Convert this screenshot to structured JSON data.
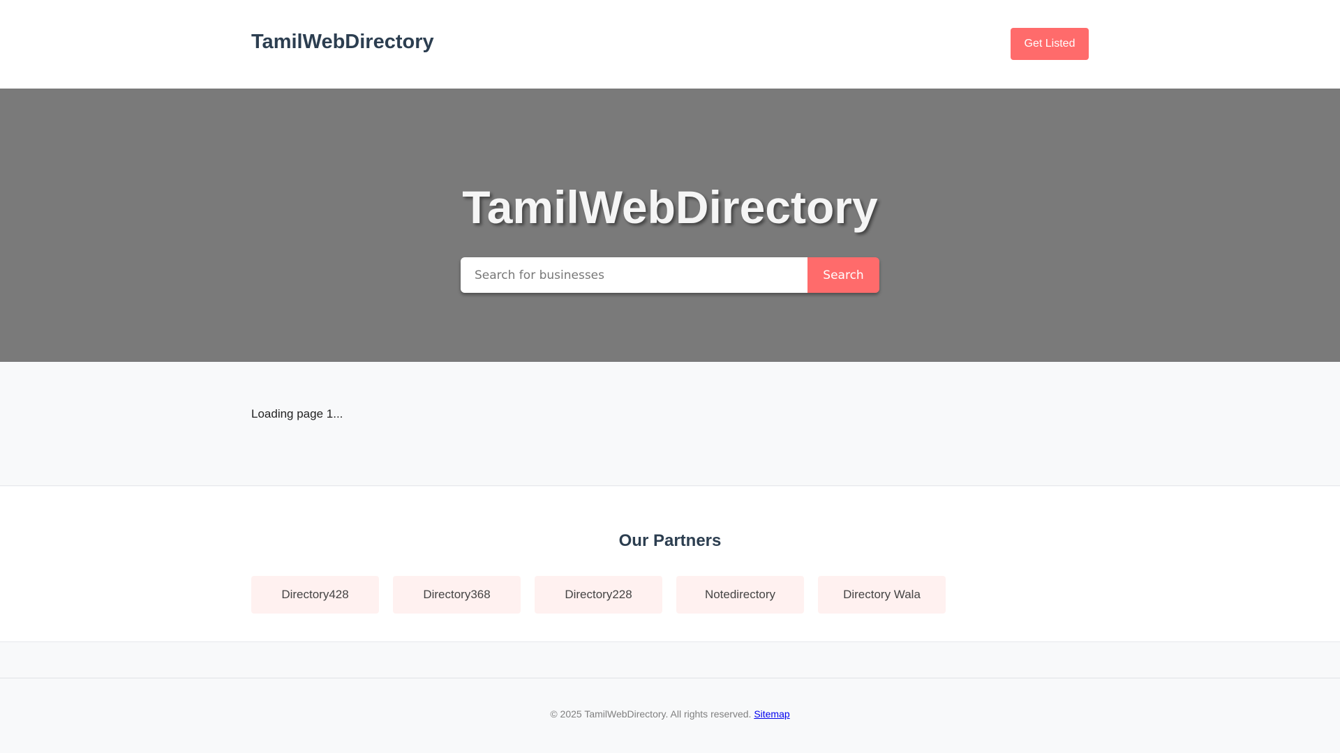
{
  "header": {
    "brand": "TamilWebDirectory",
    "cta_label": "Get Listed"
  },
  "hero": {
    "title": "TamilWebDirectory",
    "search_placeholder": "Search for businesses",
    "search_button": "Search"
  },
  "content": {
    "loading_text": "Loading page 1..."
  },
  "partners": {
    "title": "Our Partners",
    "items": [
      {
        "label": "Directory428"
      },
      {
        "label": "Directory368"
      },
      {
        "label": "Directory228"
      },
      {
        "label": "Notedirectory"
      },
      {
        "label": "Directory Wala"
      }
    ]
  },
  "footer": {
    "copyright": "© 2025 TamilWebDirectory. All rights reserved.",
    "sitemap_link": "Sitemap"
  },
  "colors": {
    "accent": "#ff6b6b",
    "hero_background": "#7a7a7a",
    "heading": "#2c3e50",
    "partner_tile": "#fff1f0"
  }
}
